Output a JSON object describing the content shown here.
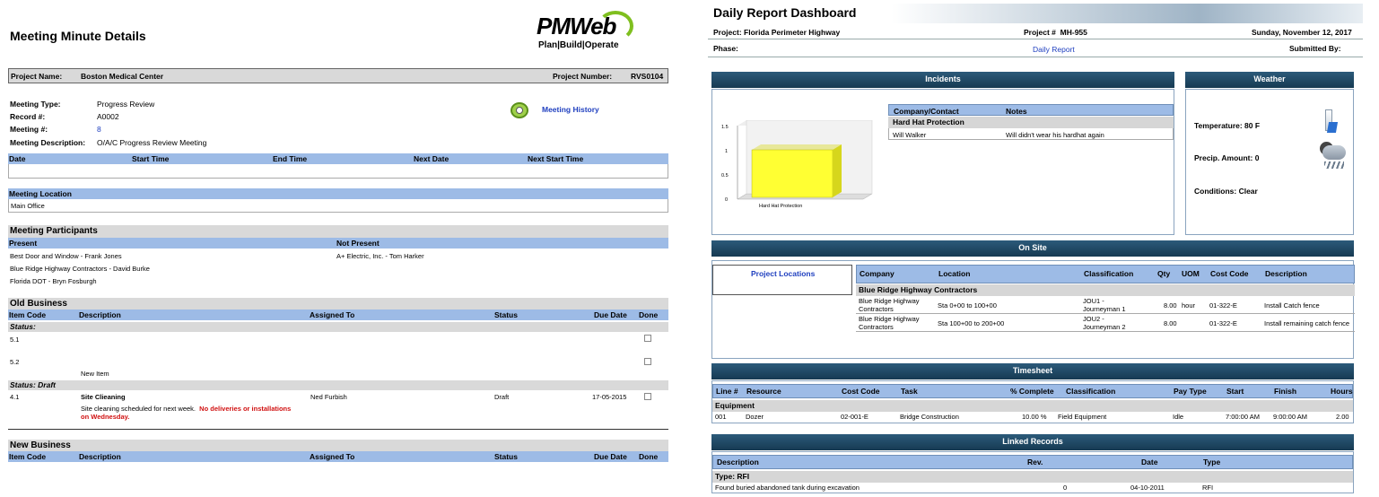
{
  "left": {
    "title": "Meeting Minute Details",
    "logo_main": "PMWeb",
    "logo_tag": "Plan|Build|Operate",
    "project_name_label": "Project Name:",
    "project_name": "Boston Medical Center",
    "project_number_label": "Project Number:",
    "project_number": "RVS0104",
    "meeting_type_label": "Meeting Type:",
    "meeting_type": "Progress Review",
    "record_label": "Record #:",
    "record": "A0002",
    "meeting_num_label": "Meeting #:",
    "meeting_num": "8",
    "meeting_desc_label": "Meeting Description:",
    "meeting_desc": "O/A/C Progress Review Meeting",
    "meeting_history": "Meeting History",
    "time_cols": [
      "Date",
      "Start Time",
      "End Time",
      "Next Date",
      "Next Start Time"
    ],
    "location_header": "Meeting Location",
    "location": "Main Office",
    "participants_header": "Meeting Participants",
    "present_label": "Present",
    "not_present_label": "Not Present",
    "present": [
      "Best Door and Window - Frank Jones",
      "Blue Ridge Highway Contractors - David  Burke",
      "Florida DOT - Bryn Fosburgh"
    ],
    "not_present": [
      "A+ Electric, Inc. - Tom Harker"
    ],
    "old_business": "Old Business",
    "new_business": "New Business",
    "business_cols": [
      "Item Code",
      "Description",
      "Assigned To",
      "Status",
      "Due Date",
      "Done"
    ],
    "status1": "Status:",
    "item51": "5.1",
    "item52": "5.2",
    "new_item": "New Item",
    "status2": "Status:   Draft",
    "item41": "4.1",
    "item41_title": "Site Clieaning",
    "item41_desc": "Site cleaning scheduled for next week.",
    "item41_warn1": "No deliveries or installations",
    "item41_warn2": "on Wednesday.",
    "item41_assigned": "Ned Furbish",
    "item41_status": "Draft",
    "item41_due": "17-05-2015"
  },
  "right": {
    "title": "Daily Report Dashboard",
    "project_label": "Project:",
    "project": "Florida Perimeter Highway",
    "project_num_label": "Project #",
    "project_num": "MH-955",
    "date": "Sunday, November 12, 2017",
    "phase_label": "Phase:",
    "daily_report": "Daily Report",
    "submitted_by": "Submitted By:",
    "incidents": "Incidents",
    "weather": "Weather",
    "chart_category": "Hard Hat Protection",
    "chart_ticks": [
      "1.5",
      "1",
      "0.5",
      "0"
    ],
    "incident_cols": [
      "Company/Contact",
      "Notes"
    ],
    "incident_group": "Hard Hat Protection",
    "incident_contact": "Will Walker",
    "incident_note": "Will didn't wear his hardhat again",
    "temperature": "Temperature: 80 F",
    "precip": "Precip. Amount: 0",
    "conditions": "Conditions: Clear",
    "on_site": "On Site",
    "project_locations": "Project Locations",
    "onsite_cols": [
      "Company",
      "Location",
      "Classification",
      "Qty",
      "UOM",
      "Cost Code",
      "Description"
    ],
    "onsite_group": "Blue Ridge Highway Contractors",
    "onsite_rows": [
      {
        "company1": "Blue Ridge Highway",
        "company2": "Contractors",
        "location": "Sta 0+00 to 100+00",
        "class1": "JOU1 -",
        "class2": "Journeyman 1",
        "qty": "8.00",
        "uom": "hour",
        "cost": "01-322-E",
        "desc": "Install Catch fence"
      },
      {
        "company1": "Blue Ridge Highway",
        "company2": "Contractors",
        "location": "Sta 100+00 to 200+00",
        "class1": "JOU2 -",
        "class2": "Journeyman 2",
        "qty": "8.00",
        "uom": "",
        "cost": "01-322-E",
        "desc": "Install remaining catch fence"
      }
    ],
    "timesheet": "Timesheet",
    "ts_cols": [
      "Line #",
      "Resource",
      "Cost Code",
      "Task",
      "% Complete",
      "Classification",
      "Pay Type",
      "Start",
      "Finish",
      "Hours"
    ],
    "ts_group": "Equipment",
    "ts_row": {
      "line": "001",
      "resource": "Dozer",
      "cost": "02-001-E",
      "task": "Bridge Construction",
      "pct": "10.00 %",
      "class": "Field Equipment",
      "pay": "Idle",
      "start": "7:00:00 AM",
      "finish": "9:00:00 AM",
      "hours": "2.00"
    },
    "linked": "Linked Records",
    "linked_cols": [
      "Description",
      "Rev.",
      "Date",
      "Type"
    ],
    "linked_group": "Type: RFI",
    "linked_row": {
      "desc": "Found buried abandoned tank during excavation",
      "rev": "0",
      "date": "04-10-2011",
      "type": "RFI"
    }
  },
  "colors": {
    "header_blue": "#9dbbe6",
    "bar_dark": "#1f4864",
    "link_blue": "#1f3fbf",
    "warn_red": "#d01010",
    "chart_yellow": "#ffff33"
  }
}
